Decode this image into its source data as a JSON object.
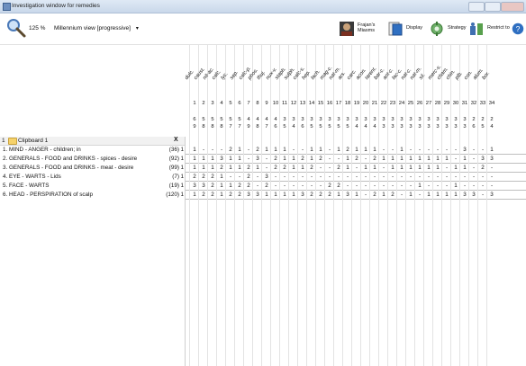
{
  "window": {
    "title": "Investigation window for remedies"
  },
  "toolbar": {
    "zoom": "125 %",
    "view_mode": "Millennium view [progressive]",
    "view_mode_chevron": "▾",
    "items": [
      {
        "label1": "Frajan's",
        "label2": "Miasms"
      },
      {
        "label1": "Display",
        "label2": ""
      },
      {
        "label1": "Strategy",
        "label2": ""
      },
      {
        "label1": "Restrict to",
        "label2": ""
      }
    ]
  },
  "clipboard": {
    "number": "1",
    "title": "Clipboard 1",
    "close": "X",
    "rubrics": [
      {
        "name": "1. MIND - ANGER - children; in",
        "count": "(36)",
        "col1": "1"
      },
      {
        "name": "2. GENERALS - FOOD and DRINKS - spices - desire",
        "count": "(92)",
        "col1": "1"
      },
      {
        "name": "3. GENERALS - FOOD and DRINKS - meat - desire",
        "count": "(99)",
        "col1": "1"
      },
      {
        "name": "4. EYE - WARTS - Lids",
        "count": "(7)",
        "col1": "1"
      },
      {
        "name": "5. FACE - WARTS",
        "count": "(19)",
        "col1": "1"
      },
      {
        "name": "6. HEAD - PERSPIRATION of scalp",
        "count": "(120)",
        "col1": "1"
      }
    ]
  },
  "remedies": {
    "names": [
      "dulc.",
      "caust.",
      "nit-ac.",
      "calc.",
      "lyc.",
      "sep.",
      "calc-p.",
      "phos.",
      "thuj.",
      "nux-v.",
      "staph.",
      "sulph.",
      "calc-s.",
      "hep.",
      "lach.",
      "mag-c.",
      "nat-m.",
      "ars.",
      "carc.",
      "acon.",
      "tarent.",
      "bar-c.",
      "ant-c.",
      "lac-c.",
      "nat-c.",
      "nat-m.",
      "sil.",
      "merc-s.",
      "cham.",
      "chin.",
      "plb.",
      "con.",
      "alum.",
      "bor."
    ],
    "idx": [
      "1",
      "2",
      "3",
      "4",
      "5",
      "6",
      "7",
      "8",
      "9",
      "10",
      "11",
      "12",
      "13",
      "14",
      "15",
      "16",
      "17",
      "18",
      "19",
      "20",
      "21",
      "22",
      "23",
      "24",
      "25",
      "26",
      "27",
      "28",
      "29",
      "30",
      "31",
      "32",
      "33",
      "34"
    ],
    "tot1": [
      "6",
      "5",
      "5",
      "5",
      "5",
      "5",
      "4",
      "4",
      "4",
      "4",
      "3",
      "3",
      "3",
      "3",
      "3",
      "3",
      "3",
      "3",
      "3",
      "3",
      "3",
      "3",
      "3",
      "3",
      "3",
      "3",
      "3",
      "3",
      "3",
      "3",
      "3",
      "2",
      "2",
      "2"
    ],
    "tot2": [
      "9",
      "8",
      "8",
      "8",
      "7",
      "7",
      "9",
      "8",
      "7",
      "6",
      "5",
      "4",
      "6",
      "5",
      "5",
      "5",
      "5",
      "5",
      "4",
      "4",
      "4",
      "3",
      "3",
      "3",
      "3",
      "3",
      "3",
      "3",
      "3",
      "3",
      "3",
      "6",
      "5",
      "4"
    ]
  },
  "grid": [
    [
      "1",
      "-",
      "-",
      "-",
      "2",
      "1",
      "-",
      "2",
      "1",
      "1",
      "1",
      "-",
      "-",
      "1",
      "1",
      "-",
      "1",
      "2",
      "1",
      "1",
      "1",
      "-",
      "-",
      "1",
      "-",
      "-",
      "-",
      "-",
      "-",
      "-",
      "3",
      "-",
      "-",
      "1"
    ],
    [
      "1",
      "1",
      "1",
      "3",
      "1",
      "1",
      "-",
      "3",
      "-",
      "2",
      "1",
      "1",
      "2",
      "1",
      "2",
      "-",
      "-",
      "1",
      "2",
      "-",
      "2",
      "1",
      "1",
      "1",
      "1",
      "1",
      "1",
      "1",
      "1",
      "-",
      "1",
      "-",
      "3",
      "3"
    ],
    [
      "1",
      "1",
      "1",
      "2",
      "1",
      "1",
      "2",
      "1",
      "-",
      "2",
      "2",
      "1",
      "1",
      "2",
      "-",
      "-",
      "2",
      "1",
      "-",
      "1",
      "1",
      "-",
      "1",
      "1",
      "1",
      "1",
      "1",
      "1",
      "-",
      "1",
      "1",
      "-",
      "2",
      "-"
    ],
    [
      "2",
      "2",
      "2",
      "1",
      "-",
      "-",
      "2",
      "-",
      "3",
      "-",
      "-",
      "-",
      "-",
      "-",
      "-",
      "-",
      "-",
      "-",
      "-",
      "-",
      "-",
      "-",
      "-",
      "-",
      "-",
      "-",
      "-",
      "-",
      "-",
      "-",
      "-",
      "-",
      "-",
      "-"
    ],
    [
      "3",
      "3",
      "2",
      "1",
      "1",
      "2",
      "2",
      "-",
      "2",
      "-",
      "-",
      "-",
      "-",
      "-",
      "-",
      "2",
      "2",
      "-",
      "-",
      "-",
      "-",
      "-",
      "-",
      "-",
      "-",
      "1",
      "-",
      "-",
      "-",
      "1",
      "-",
      "-",
      "-",
      "-"
    ],
    [
      "1",
      "2",
      "2",
      "1",
      "2",
      "2",
      "3",
      "3",
      "1",
      "1",
      "1",
      "1",
      "3",
      "2",
      "2",
      "2",
      "1",
      "3",
      "1",
      "-",
      "2",
      "1",
      "2",
      "-",
      "1",
      "-",
      "1",
      "1",
      "1",
      "1",
      "3",
      "3",
      "-",
      "3"
    ]
  ]
}
